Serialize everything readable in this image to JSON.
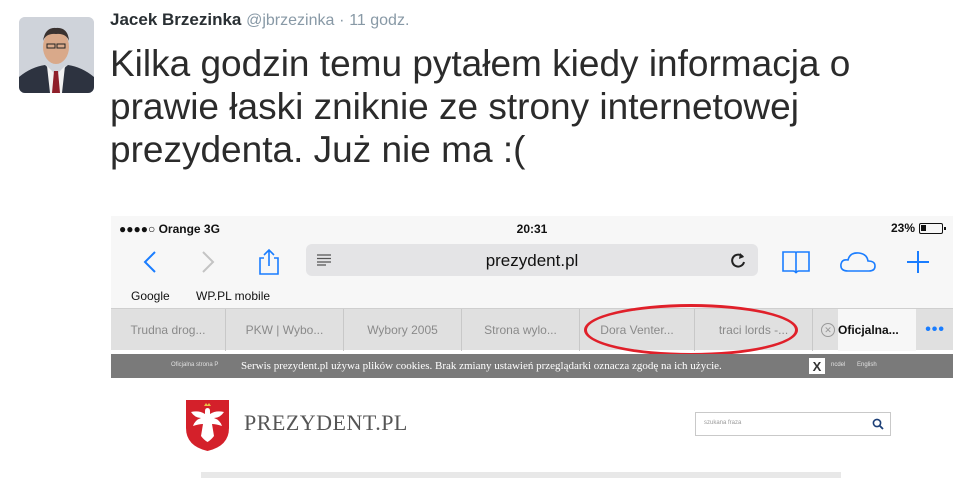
{
  "tweet": {
    "name": "Jacek Brzezinka",
    "handle": "@jbrzezinka",
    "separator": "·",
    "time": "11 godz.",
    "text": "Kilka godzin temu pytałem kiedy informacja o prawie łaski zniknie ze strony internetowej prezydenta. Już nie ma :("
  },
  "screenshot": {
    "status_bar": {
      "carrier": "●●●●○ Orange  3G",
      "time": "20:31",
      "battery": "23%"
    },
    "toolbar": {
      "url": "prezydent.pl",
      "icons": [
        "back-icon",
        "forward-icon",
        "share-icon",
        "reader-icon",
        "reload-icon",
        "bookmarks-book-icon",
        "icloud-tabs-icon",
        "new-tab-plus-icon"
      ],
      "accent_color": "#1a7dff"
    },
    "bookmarks": [
      "Google",
      "WP.PL mobile"
    ],
    "tabs": [
      {
        "label": "Trudna drog..."
      },
      {
        "label": "PKW | Wybo..."
      },
      {
        "label": "Wybory 2005"
      },
      {
        "label": "Strona wylo..."
      },
      {
        "label": "Dora Venter..."
      },
      {
        "label": "traci lords -..."
      },
      {
        "label": "Oficjalna..."
      }
    ],
    "tabs_more": "•••",
    "highlight_color": "#e0202a",
    "cookie_bar": {
      "left_small": "Oficjalna strona P",
      "text": "Serwis prezydent.pl używa plików cookies. Brak zmiany ustawień przeglądarki oznacza zgodę na ich użycie.",
      "close": "X",
      "right_small": "English",
      "right_small2": "ncdel"
    },
    "site": {
      "logo_text": "PREZYDENT.PL",
      "search_placeholder": "szukana fraza"
    }
  }
}
